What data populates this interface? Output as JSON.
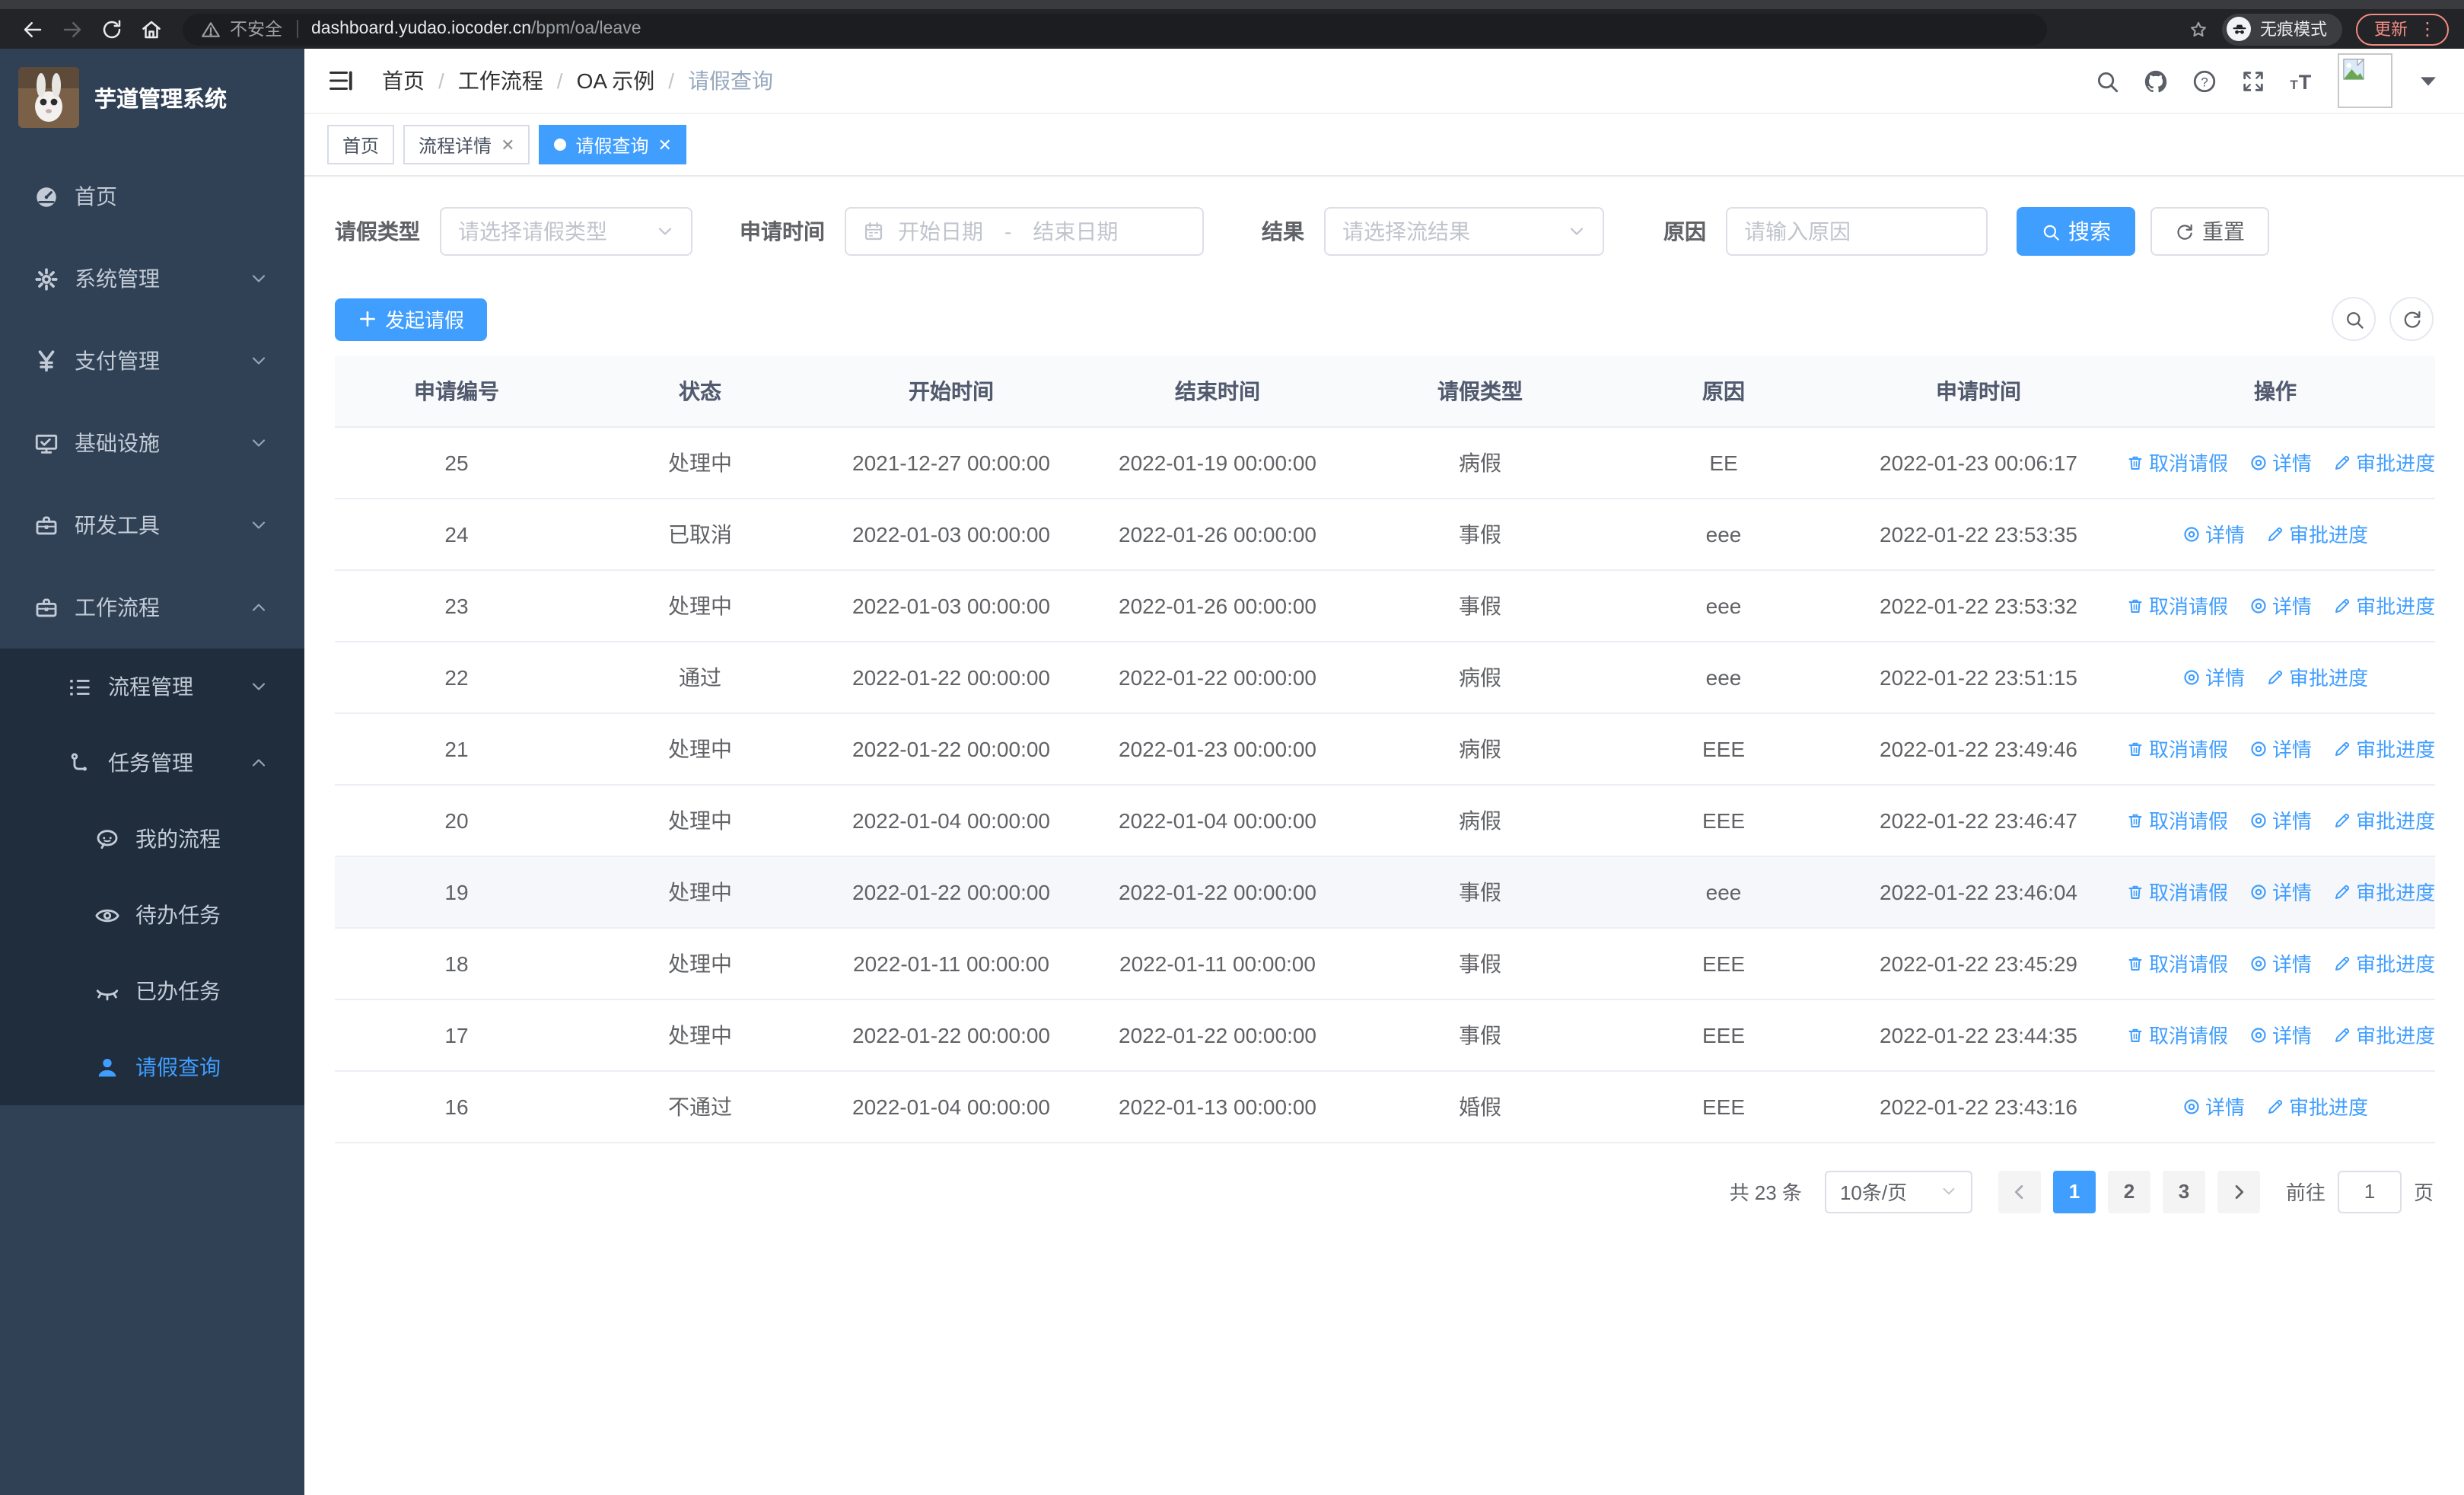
{
  "browser": {
    "security_label": "不安全",
    "url_host": "dashboard.yudao.iocoder.cn",
    "url_path": "/bpm/oa/leave",
    "incognito_label": "无痕模式",
    "update_label": "更新"
  },
  "sidebar": {
    "title": "芋道管理系统",
    "items": [
      {
        "label": "首页",
        "icon": "dashboard-icon",
        "level": 1,
        "chevron": "",
        "group": "top",
        "active": false
      },
      {
        "label": "系统管理",
        "icon": "gear-icon",
        "level": 1,
        "chevron": "down",
        "group": "top",
        "active": false
      },
      {
        "label": "支付管理",
        "icon": "yen-icon",
        "level": 1,
        "chevron": "down",
        "group": "top",
        "active": false
      },
      {
        "label": "基础设施",
        "icon": "monitor-icon",
        "level": 1,
        "chevron": "down",
        "group": "top",
        "active": false
      },
      {
        "label": "研发工具",
        "icon": "briefcase-icon",
        "level": 1,
        "chevron": "down",
        "group": "top",
        "active": false
      },
      {
        "label": "工作流程",
        "icon": "briefcase-icon",
        "level": 1,
        "chevron": "up",
        "group": "top",
        "active": false
      },
      {
        "label": "流程管理",
        "icon": "list-icon",
        "level": 2,
        "chevron": "down",
        "group": "sub",
        "active": false
      },
      {
        "label": "任务管理",
        "icon": "workflow-icon",
        "level": 2,
        "chevron": "up",
        "group": "sub",
        "active": false
      },
      {
        "label": "我的流程",
        "icon": "chat-icon",
        "level": 3,
        "chevron": "",
        "group": "sub",
        "active": false
      },
      {
        "label": "待办任务",
        "icon": "eye-icon",
        "level": 3,
        "chevron": "",
        "group": "sub",
        "active": false
      },
      {
        "label": "已办任务",
        "icon": "eye-off-icon",
        "level": 3,
        "chevron": "",
        "group": "sub",
        "active": false
      },
      {
        "label": "请假查询",
        "icon": "user-icon",
        "level": 3,
        "chevron": "",
        "group": "sub",
        "active": true
      }
    ]
  },
  "header": {
    "breadcrumb": [
      "首页",
      "工作流程",
      "OA 示例",
      "请假查询"
    ]
  },
  "tabs": [
    {
      "label": "首页",
      "closable": false,
      "active": false
    },
    {
      "label": "流程详情",
      "closable": true,
      "active": false
    },
    {
      "label": "请假查询",
      "closable": true,
      "active": true
    }
  ],
  "filters": {
    "leave_type": {
      "label": "请假类型",
      "placeholder": "请选择请假类型"
    },
    "apply_time": {
      "label": "申请时间",
      "start_placeholder": "开始日期",
      "separator": "-",
      "end_placeholder": "结束日期"
    },
    "result": {
      "label": "结果",
      "placeholder": "请选择流结果"
    },
    "reason": {
      "label": "原因",
      "placeholder": "请输入原因"
    },
    "search_label": "搜索",
    "reset_label": "重置"
  },
  "actions_bar": {
    "create_label": "发起请假"
  },
  "table": {
    "columns": [
      "申请编号",
      "状态",
      "开始时间",
      "结束时间",
      "请假类型",
      "原因",
      "申请时间",
      "操作"
    ],
    "action_labels": {
      "cancel": "取消请假",
      "detail": "详情",
      "progress": "审批进度"
    },
    "rows": [
      {
        "id": "25",
        "status": "处理中",
        "start": "2021-12-27 00:00:00",
        "end": "2022-01-19 00:00:00",
        "type": "病假",
        "reason": "EE",
        "applied": "2022-01-23 00:06:17",
        "actions": [
          "cancel",
          "detail",
          "progress"
        ],
        "hover": false
      },
      {
        "id": "24",
        "status": "已取消",
        "start": "2022-01-03 00:00:00",
        "end": "2022-01-26 00:00:00",
        "type": "事假",
        "reason": "eee",
        "applied": "2022-01-22 23:53:35",
        "actions": [
          "detail",
          "progress"
        ],
        "hover": false
      },
      {
        "id": "23",
        "status": "处理中",
        "start": "2022-01-03 00:00:00",
        "end": "2022-01-26 00:00:00",
        "type": "事假",
        "reason": "eee",
        "applied": "2022-01-22 23:53:32",
        "actions": [
          "cancel",
          "detail",
          "progress"
        ],
        "hover": false
      },
      {
        "id": "22",
        "status": "通过",
        "start": "2022-01-22 00:00:00",
        "end": "2022-01-22 00:00:00",
        "type": "病假",
        "reason": "eee",
        "applied": "2022-01-22 23:51:15",
        "actions": [
          "detail",
          "progress"
        ],
        "hover": false
      },
      {
        "id": "21",
        "status": "处理中",
        "start": "2022-01-22 00:00:00",
        "end": "2022-01-23 00:00:00",
        "type": "病假",
        "reason": "EEE",
        "applied": "2022-01-22 23:49:46",
        "actions": [
          "cancel",
          "detail",
          "progress"
        ],
        "hover": false
      },
      {
        "id": "20",
        "status": "处理中",
        "start": "2022-01-04 00:00:00",
        "end": "2022-01-04 00:00:00",
        "type": "病假",
        "reason": "EEE",
        "applied": "2022-01-22 23:46:47",
        "actions": [
          "cancel",
          "detail",
          "progress"
        ],
        "hover": false
      },
      {
        "id": "19",
        "status": "处理中",
        "start": "2022-01-22 00:00:00",
        "end": "2022-01-22 00:00:00",
        "type": "事假",
        "reason": "eee",
        "applied": "2022-01-22 23:46:04",
        "actions": [
          "cancel",
          "detail",
          "progress"
        ],
        "hover": true
      },
      {
        "id": "18",
        "status": "处理中",
        "start": "2022-01-11 00:00:00",
        "end": "2022-01-11 00:00:00",
        "type": "事假",
        "reason": "EEE",
        "applied": "2022-01-22 23:45:29",
        "actions": [
          "cancel",
          "detail",
          "progress"
        ],
        "hover": false
      },
      {
        "id": "17",
        "status": "处理中",
        "start": "2022-01-22 00:00:00",
        "end": "2022-01-22 00:00:00",
        "type": "事假",
        "reason": "EEE",
        "applied": "2022-01-22 23:44:35",
        "actions": [
          "cancel",
          "detail",
          "progress"
        ],
        "hover": false
      },
      {
        "id": "16",
        "status": "不通过",
        "start": "2022-01-04 00:00:00",
        "end": "2022-01-13 00:00:00",
        "type": "婚假",
        "reason": "EEE",
        "applied": "2022-01-22 23:43:16",
        "actions": [
          "detail",
          "progress"
        ],
        "hover": false
      }
    ]
  },
  "pagination": {
    "total_label": "共 23 条",
    "page_size_label": "10条/页",
    "pages": [
      "1",
      "2",
      "3"
    ],
    "current_page": "1",
    "goto_label": "前往",
    "goto_value": "1",
    "page_unit_label": "页"
  },
  "colors": {
    "primary": "#409eff",
    "sidebar_bg": "#304156",
    "submenu_bg": "#1f2d3d",
    "update_accent": "#f28b82"
  }
}
